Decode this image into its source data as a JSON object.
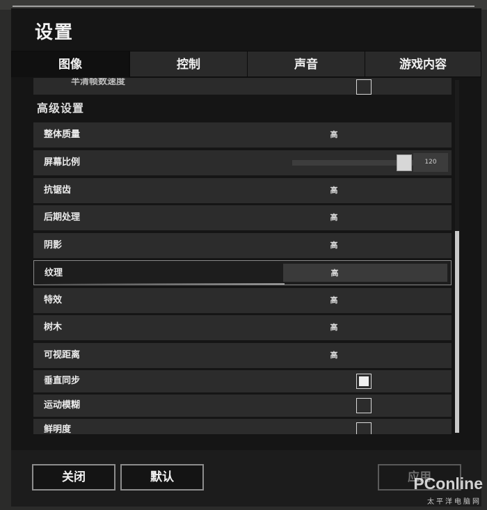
{
  "title": "设置",
  "tabs": [
    {
      "label": "图像",
      "active": true
    },
    {
      "label": "控制",
      "active": false
    },
    {
      "label": "声音",
      "active": false
    },
    {
      "label": "游戏内容",
      "active": false
    }
  ],
  "cut_row_label": "半清帧数速度",
  "section_title": "高级设置",
  "settings": [
    {
      "label": "整体质量",
      "value": "高"
    },
    {
      "label": "屏幕比例",
      "slider_value": "120"
    },
    {
      "label": "抗锯齿",
      "value": "高"
    },
    {
      "label": "后期处理",
      "value": "高"
    },
    {
      "label": "阴影",
      "value": "高"
    },
    {
      "label": "纹理",
      "value": "高"
    },
    {
      "label": "特效",
      "value": "高"
    },
    {
      "label": "树木",
      "value": "高"
    },
    {
      "label": "可视距离",
      "value": "高"
    },
    {
      "label": "垂直同步",
      "checked": true
    },
    {
      "label": "运动模糊",
      "checked": false
    },
    {
      "label": "鲜明度",
      "checked": false
    }
  ],
  "buttons": {
    "close": "关闭",
    "default": "默认",
    "apply": "应用"
  },
  "watermark": {
    "brand": "PConline",
    "sub": "太平洋电脑网"
  }
}
